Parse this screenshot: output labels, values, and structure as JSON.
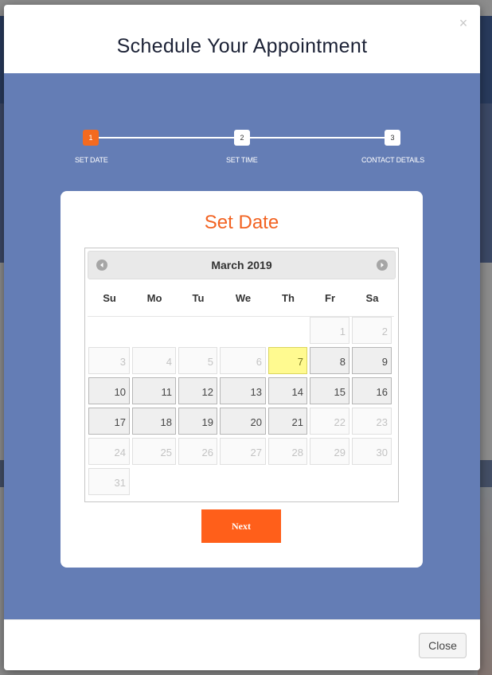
{
  "modal": {
    "title": "Schedule Your Appointment",
    "close_label": "Close",
    "close_icon": "×"
  },
  "stepper": {
    "steps": [
      {
        "number": "1",
        "label": "SET DATE",
        "active": true
      },
      {
        "number": "2",
        "label": "SET TIME",
        "active": false
      },
      {
        "number": "3",
        "label": "CONTACT DETAILS",
        "active": false
      }
    ]
  },
  "card": {
    "title": "Set Date",
    "next_label": "Next"
  },
  "calendar": {
    "month_label": "March 2019",
    "weekdays": [
      "Su",
      "Mo",
      "Tu",
      "We",
      "Th",
      "Fr",
      "Sa"
    ],
    "weeks": [
      [
        null,
        null,
        null,
        null,
        null,
        {
          "d": "1",
          "s": "disabled"
        },
        {
          "d": "2",
          "s": "disabled"
        }
      ],
      [
        {
          "d": "3",
          "s": "disabled"
        },
        {
          "d": "4",
          "s": "disabled"
        },
        {
          "d": "5",
          "s": "disabled"
        },
        {
          "d": "6",
          "s": "disabled"
        },
        {
          "d": "7",
          "s": "today"
        },
        {
          "d": "8",
          "s": "avail"
        },
        {
          "d": "9",
          "s": "avail"
        }
      ],
      [
        {
          "d": "10",
          "s": "avail"
        },
        {
          "d": "11",
          "s": "avail"
        },
        {
          "d": "12",
          "s": "avail"
        },
        {
          "d": "13",
          "s": "avail"
        },
        {
          "d": "14",
          "s": "avail"
        },
        {
          "d": "15",
          "s": "avail"
        },
        {
          "d": "16",
          "s": "avail"
        }
      ],
      [
        {
          "d": "17",
          "s": "avail"
        },
        {
          "d": "18",
          "s": "avail"
        },
        {
          "d": "19",
          "s": "avail"
        },
        {
          "d": "20",
          "s": "avail"
        },
        {
          "d": "21",
          "s": "avail"
        },
        {
          "d": "22",
          "s": "disabled"
        },
        {
          "d": "23",
          "s": "disabled"
        }
      ],
      [
        {
          "d": "24",
          "s": "disabled"
        },
        {
          "d": "25",
          "s": "disabled"
        },
        {
          "d": "26",
          "s": "disabled"
        },
        {
          "d": "27",
          "s": "disabled"
        },
        {
          "d": "28",
          "s": "disabled"
        },
        {
          "d": "29",
          "s": "disabled"
        },
        {
          "d": "30",
          "s": "disabled"
        }
      ],
      [
        {
          "d": "31",
          "s": "disabled"
        },
        null,
        null,
        null,
        null,
        null,
        null
      ]
    ]
  },
  "icons": {
    "prev": "chevron-left-icon",
    "next": "chevron-right-icon",
    "close": "close-icon"
  },
  "colors": {
    "accent": "#f46a1f",
    "modal_body": "#647db5",
    "today_highlight": "#fffa90"
  }
}
